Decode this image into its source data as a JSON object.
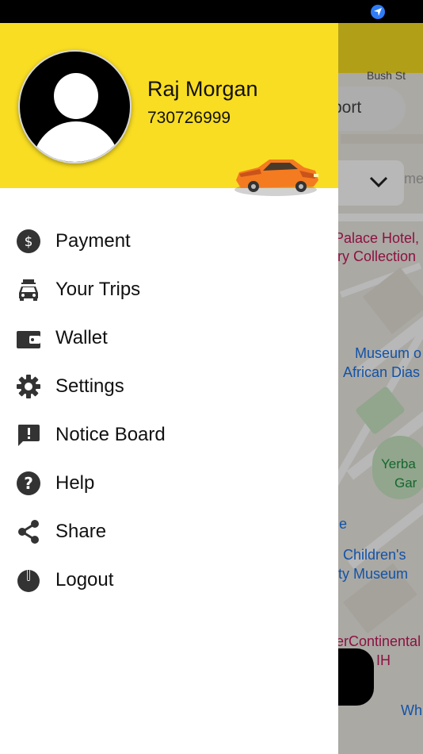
{
  "user": {
    "name": "Raj Morgan",
    "phone": "730726999"
  },
  "menu": [
    {
      "label": "Payment",
      "icon": "dollar-icon"
    },
    {
      "label": "Your Trips",
      "icon": "car-luggage-icon"
    },
    {
      "label": "Wallet",
      "icon": "wallet-icon"
    },
    {
      "label": "Settings",
      "icon": "gear-icon"
    },
    {
      "label": "Notice Board",
      "icon": "alert-message-icon"
    },
    {
      "label": "Help",
      "icon": "help-icon"
    },
    {
      "label": "Share",
      "icon": "share-icon"
    },
    {
      "label": "Logout",
      "icon": "power-icon"
    }
  ],
  "map": {
    "street": "Bush St",
    "search_text": "port",
    "dropdown_text": "me",
    "poi": [
      "Palace Hotel,",
      "ry Collection",
      "Museum o",
      "African Dias",
      "Yerba",
      "Gar",
      "Children's",
      "ty Museum",
      "erContinental",
      "o, an IH",
      "Wh",
      "e"
    ]
  },
  "colors": {
    "header": "#f9dd22",
    "car": "#f47b20",
    "location": "#2f7cf6"
  }
}
